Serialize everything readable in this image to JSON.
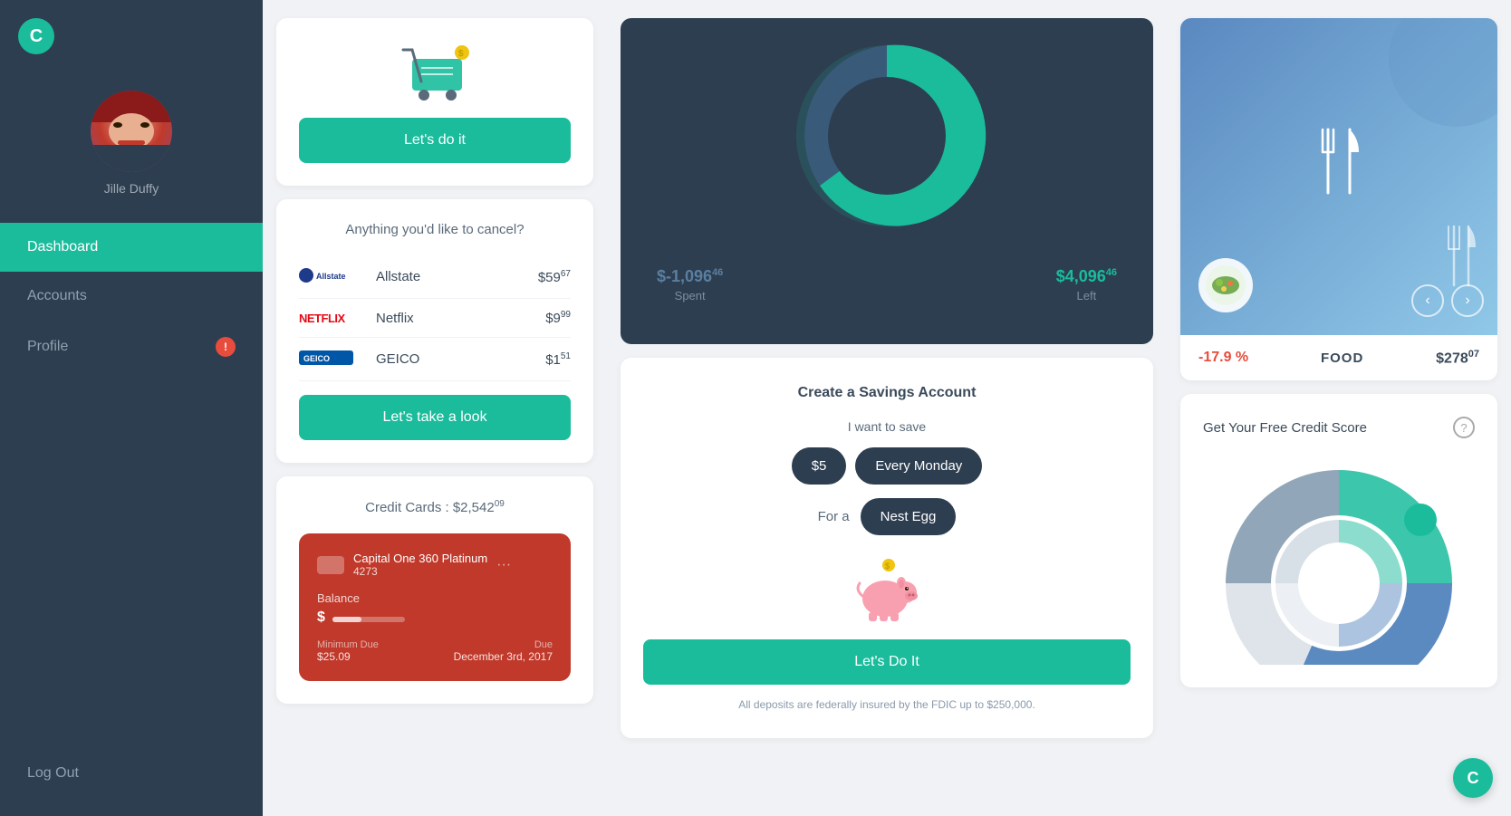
{
  "app": {
    "logo": "C",
    "brand_color": "#1abc9c"
  },
  "sidebar": {
    "user": {
      "name": "Jille Duffy"
    },
    "nav": [
      {
        "id": "dashboard",
        "label": "Dashboard",
        "active": true,
        "badge": null
      },
      {
        "id": "accounts",
        "label": "Accounts",
        "active": false,
        "badge": null
      },
      {
        "id": "profile",
        "label": "Profile",
        "active": false,
        "badge": "!"
      }
    ],
    "logout_label": "Log Out"
  },
  "col1": {
    "cart_card": {
      "btn_label": "Let's do it"
    },
    "cancel_card": {
      "title": "Anything you'd like to cancel?",
      "items": [
        {
          "name": "Allstate",
          "amount": "$59",
          "cents": "67",
          "logo_type": "allstate"
        },
        {
          "name": "Netflix",
          "amount": "$9",
          "cents": "99",
          "logo_type": "netflix"
        },
        {
          "name": "GEICO",
          "amount": "$1",
          "cents": "51",
          "logo_type": "geico"
        }
      ],
      "btn_label": "Let's take a look"
    },
    "credit_card": {
      "title": "Credit Cards : $2,542",
      "title_cents": "09",
      "card": {
        "name": "Capital One 360 Platinum",
        "number": "4273",
        "dots": "...",
        "balance_label": "Balance",
        "balance_symbol": "$",
        "min_due_label": "Minimum Due",
        "min_due_value": "$25.09",
        "due_label": "Due",
        "due_value": "December 3rd, 2017"
      }
    }
  },
  "col2": {
    "budget": {
      "spent_val": "$-1,096",
      "spent_cents": "46",
      "spent_label": "Spent",
      "left_val": "$4,096",
      "left_cents": "46",
      "left_label": "Left"
    },
    "savings": {
      "title": "Create a Savings Account",
      "i_want_label": "I want to save",
      "amount_pill": "$5",
      "frequency_pill": "Every Monday",
      "for_label": "For a",
      "purpose_pill": "Nest Egg",
      "btn_label": "Let's Do It",
      "disclaimer": "All deposits are federally insured by the FDIC up to $250,000."
    }
  },
  "col3": {
    "food": {
      "percentage": "-17.9 %",
      "label": "FOOD",
      "amount": "$278",
      "amount_cents": "07",
      "prev_icon": "←",
      "next_icon": "→"
    },
    "credit_score": {
      "title": "Get Your Free Credit Score",
      "help_icon": "?"
    }
  }
}
